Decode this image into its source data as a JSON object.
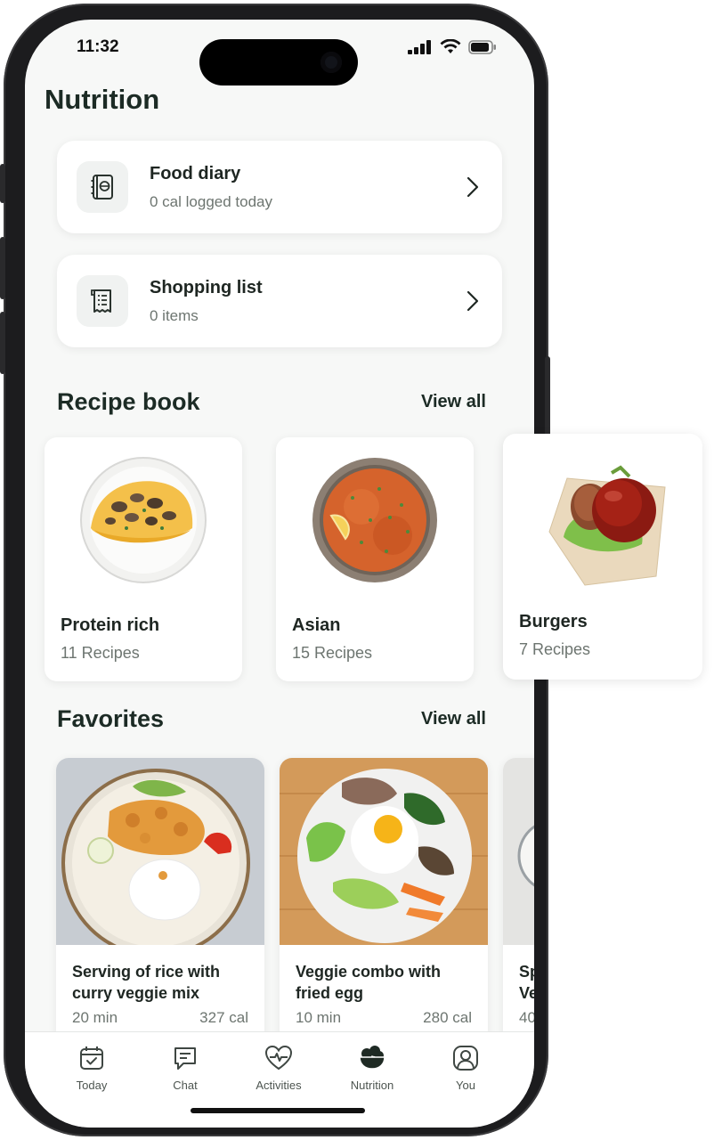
{
  "status_bar": {
    "time": "11:32"
  },
  "page": {
    "title": "Nutrition"
  },
  "cards": [
    {
      "title": "Food diary",
      "subtitle": "0 cal logged today",
      "icon": "food-diary-icon"
    },
    {
      "title": "Shopping list",
      "subtitle": "0 items",
      "icon": "receipt-list-icon"
    }
  ],
  "recipe_book": {
    "title": "Recipe book",
    "view_all": "View all",
    "items": [
      {
        "name": "Protein rich",
        "count": "11 Recipes"
      },
      {
        "name": "Asian",
        "count": "15 Recipes"
      },
      {
        "name": "Burgers",
        "count": "7 Recipes"
      }
    ]
  },
  "favorites": {
    "title": "Favorites",
    "view_all": "View all",
    "items": [
      {
        "name": "Serving of rice with curry veggie mix",
        "time": "20 min",
        "cal": "327 cal"
      },
      {
        "name": "Veggie combo with fried egg",
        "time": "10 min",
        "cal": "280 cal"
      },
      {
        "name": "Sp Ve",
        "time": "40"
      }
    ]
  },
  "tabs": [
    {
      "label": "Today",
      "icon": "calendar-check-icon"
    },
    {
      "label": "Chat",
      "icon": "chat-bubble-icon"
    },
    {
      "label": "Activities",
      "icon": "heart-pulse-icon"
    },
    {
      "label": "Nutrition",
      "icon": "salad-bowl-icon",
      "active": true
    },
    {
      "label": "You",
      "icon": "user-icon"
    }
  ],
  "colors": {
    "primary_text": "#1c2b25",
    "secondary_text": "#6d7570",
    "background": "#f7f8f7",
    "card": "#ffffff"
  }
}
